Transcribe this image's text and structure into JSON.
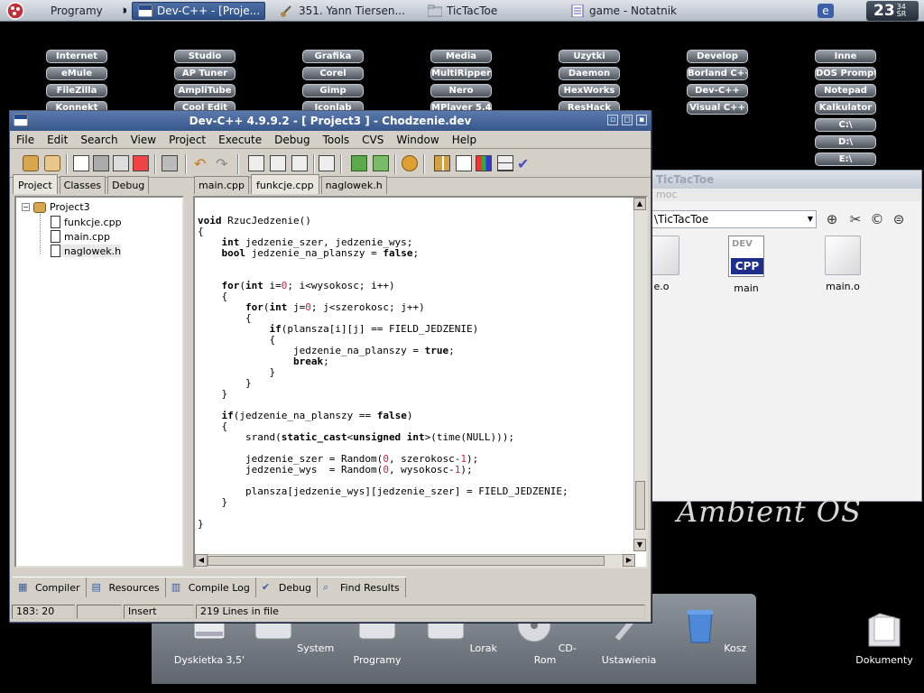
{
  "taskbar": {
    "tasks": [
      "Programy",
      "Dev-C++ - [Proje...",
      "351. Yann Tiersen...",
      "TicTacToe",
      "game - Notatnik"
    ],
    "clock_time": "23",
    "clock_minutes": "34",
    "clock_day": "ŚR"
  },
  "launcher": [
    [
      "Internet",
      "eMule",
      "FileZilla",
      "Konnekt"
    ],
    [
      "Studio",
      "AP Tuner",
      "AmpliTube",
      "Cool Edit"
    ],
    [
      "Grafika",
      "Corel",
      "Gimp",
      "Iconlab"
    ],
    [
      "Media",
      "MultiRipper",
      "Nero",
      "MPlayer 5.4"
    ],
    [
      "Uzytki",
      "Daemon",
      "HexWorks",
      "ResHack"
    ],
    [
      "Develop",
      "Borland C++",
      "Dev-C++",
      "Visual C++"
    ],
    [
      "Inne",
      "DOS Prompt",
      "Notepad",
      "Kalkulator",
      "C:\\",
      "D:\\",
      "E:\\"
    ]
  ],
  "file_window": {
    "title": "TicTacToe",
    "menu_fragment": "moc",
    "path": "\\TicTacToe",
    "files": [
      {
        "name": "e.o"
      },
      {
        "name": "main",
        "icon_text": "CPP"
      },
      {
        "name": "main.o"
      }
    ]
  },
  "ambient_logo": "Ambient  OS",
  "dock": {
    "items": [
      "Dyskietka 3,5'",
      "System",
      "Programy",
      "Lorak",
      "CD-Rom",
      "Ustawienia",
      "Kosz"
    ],
    "desktop_icon": "Dokumenty"
  },
  "window": {
    "title": "Dev-C++ 4.9.9.2  - [ Project3 ] - Chodzenie.dev",
    "menu": [
      "File",
      "Edit",
      "Search",
      "View",
      "Project",
      "Execute",
      "Debug",
      "Tools",
      "CVS",
      "Window",
      "Help"
    ],
    "left_tabs": [
      "Project",
      "Classes",
      "Debug"
    ],
    "tree": {
      "root": "Project3",
      "children": [
        "funkcje.cpp",
        "main.cpp",
        "naglowek.h"
      ]
    },
    "editor_tabs": [
      "main.cpp",
      "funkcje.cpp",
      "naglowek.h"
    ],
    "active_editor_tab": "funkcje.cpp",
    "bottom_tabs": [
      "Compiler",
      "Resources",
      "Compile Log",
      "Debug",
      "Find Results"
    ],
    "status": {
      "position": "183: 20",
      "modified": "",
      "mode": "Insert",
      "lines": "219 Lines in file"
    }
  },
  "code_lines": [
    [],
    [
      {
        "t": "void",
        "c": "kw"
      },
      {
        "t": " RzucJedzenie()"
      }
    ],
    [
      {
        "t": "{"
      }
    ],
    [
      {
        "t": "    "
      },
      {
        "t": "int",
        "c": "kw"
      },
      {
        "t": " jedzenie_szer, jedzenie_wys;"
      }
    ],
    [
      {
        "t": "    "
      },
      {
        "t": "bool",
        "c": "kw"
      },
      {
        "t": " jedzenie_na_planszy = "
      },
      {
        "t": "false",
        "c": "kw"
      },
      {
        "t": ";"
      }
    ],
    [],
    [],
    [
      {
        "t": "    "
      },
      {
        "t": "for",
        "c": "kw"
      },
      {
        "t": "("
      },
      {
        "t": "int",
        "c": "kw"
      },
      {
        "t": " i="
      },
      {
        "t": "0",
        "c": "nm"
      },
      {
        "t": "; i<wysokosc; i++)"
      }
    ],
    [
      {
        "t": "    {"
      }
    ],
    [
      {
        "t": "        "
      },
      {
        "t": "for",
        "c": "kw"
      },
      {
        "t": "("
      },
      {
        "t": "int",
        "c": "kw"
      },
      {
        "t": " j="
      },
      {
        "t": "0",
        "c": "nm"
      },
      {
        "t": "; j<szerokosc; j++)"
      }
    ],
    [
      {
        "t": "        {"
      }
    ],
    [
      {
        "t": "            "
      },
      {
        "t": "if",
        "c": "kw"
      },
      {
        "t": "(plansza[i][j] == FIELD_JEDZENIE)"
      }
    ],
    [
      {
        "t": "            {"
      }
    ],
    [
      {
        "t": "                jedzenie_na_planszy = "
      },
      {
        "t": "true",
        "c": "kw"
      },
      {
        "t": ";"
      }
    ],
    [
      {
        "t": "                "
      },
      {
        "t": "break",
        "c": "kw"
      },
      {
        "t": ";"
      }
    ],
    [
      {
        "t": "            }"
      }
    ],
    [
      {
        "t": "        }"
      }
    ],
    [
      {
        "t": "    }"
      }
    ],
    [],
    [
      {
        "t": "    "
      },
      {
        "t": "if",
        "c": "kw"
      },
      {
        "t": "(jedzenie_na_planszy == "
      },
      {
        "t": "false",
        "c": "kw"
      },
      {
        "t": ")"
      }
    ],
    [
      {
        "t": "    {"
      }
    ],
    [
      {
        "t": "        srand("
      },
      {
        "t": "static_cast",
        "c": "kw"
      },
      {
        "t": "<"
      },
      {
        "t": "unsigned int",
        "c": "kw"
      },
      {
        "t": ">(time(NULL)));"
      }
    ],
    [],
    [
      {
        "t": "        jedzenie_szer = Random("
      },
      {
        "t": "0",
        "c": "nm"
      },
      {
        "t": ", szerokosc-"
      },
      {
        "t": "1",
        "c": "nm"
      },
      {
        "t": ");"
      }
    ],
    [
      {
        "t": "        jedzenie_wys  = Random("
      },
      {
        "t": "0",
        "c": "nm"
      },
      {
        "t": ", wysokosc-"
      },
      {
        "t": "1",
        "c": "nm"
      },
      {
        "t": ");"
      }
    ],
    [],
    [
      {
        "t": "        plansza[jedzenie_wys][jedzenie_szer] = FIELD_JEDZENIE;"
      }
    ],
    [
      {
        "t": "    }"
      }
    ],
    [],
    [
      {
        "t": "}"
      }
    ]
  ],
  "colors": {
    "title_active": "#37568a",
    "keyword": "#000000",
    "number": "#d0204a"
  }
}
